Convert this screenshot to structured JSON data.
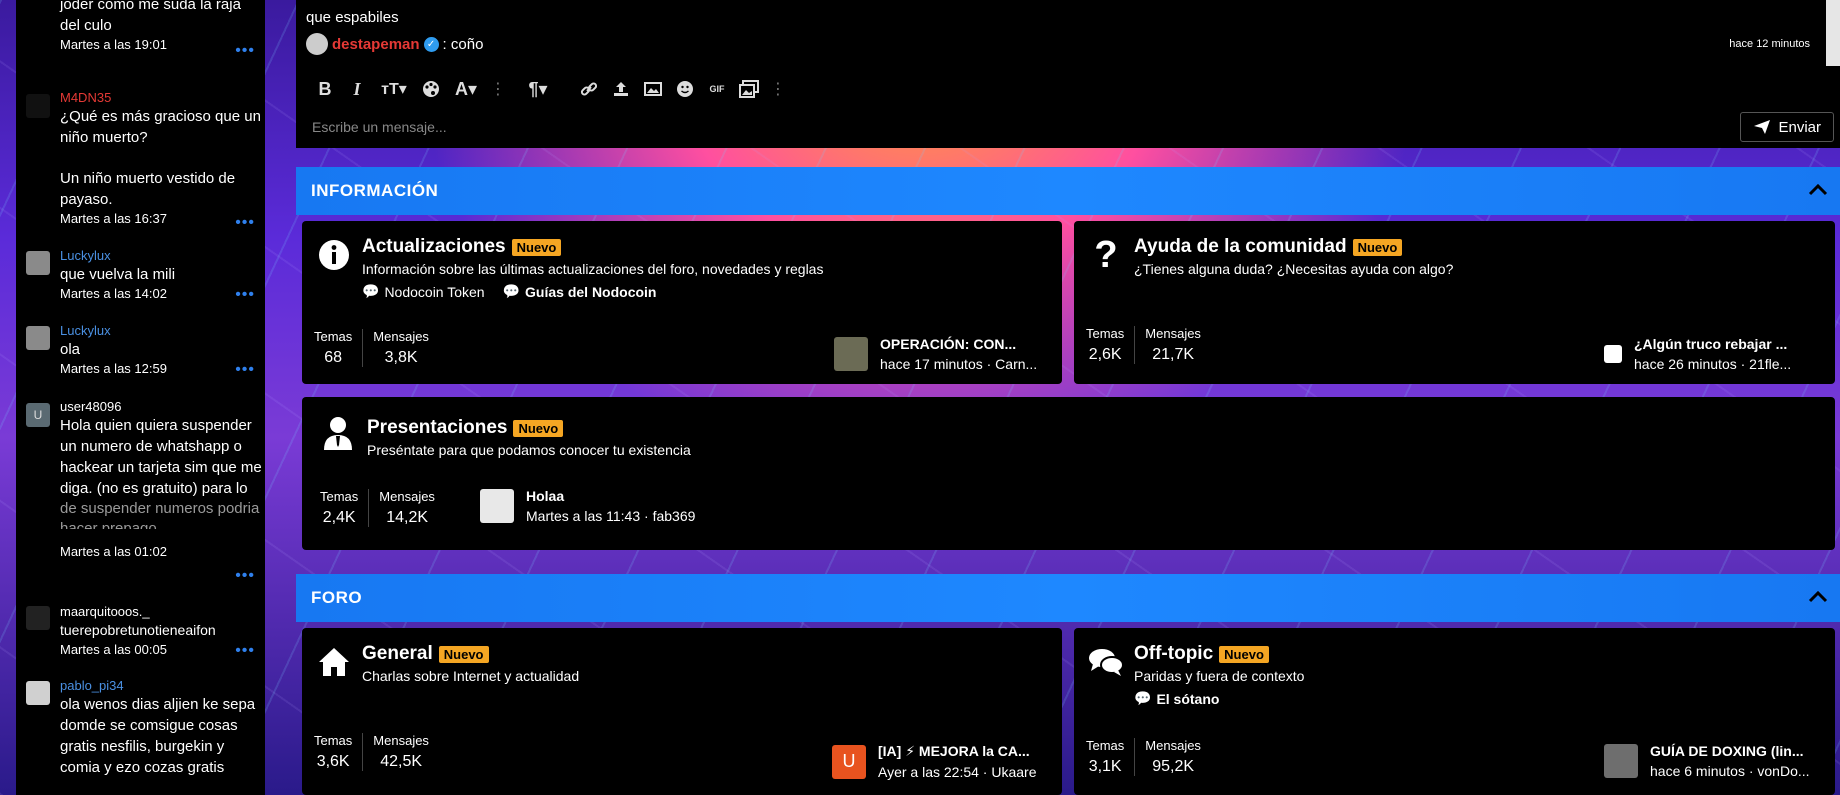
{
  "shoutbox": {
    "messages": [
      {
        "user": "",
        "text": "joder como me suda la raja del culo",
        "time": "Martes a las 19:01"
      },
      {
        "user": "M4DN35",
        "text": "¿Qué es más gracioso que un niño muerto?",
        "text2": "Un niño muerto vestido de payaso.",
        "time": "Martes a las 16:37"
      },
      {
        "user": "Luckylux",
        "text": "que vuelva la mili",
        "time": "Martes a las 14:02"
      },
      {
        "user": "Luckylux",
        "text": "ola",
        "time": "Martes a las 12:59"
      },
      {
        "user": "user48096",
        "avatar_letter": "U",
        "text": "Hola quien quiera suspender un numero de whatshapp o hackear un tarjeta sim que me diga. (no es gratuito) para lo",
        "text_faded": "de suspender numeros podria hacer prepago",
        "time": "Martes a las 01:02"
      },
      {
        "user": "maarquitooos._",
        "text": "tuerepobretunotieneaifon",
        "time": "Martes a las 00:05"
      },
      {
        "user": "pablo_pi34",
        "text": "ola wenos dias aljien ke sepa domde se comsigue cosas gratis nesfilis, burgekin y comia y ezo cozas gratis"
      }
    ],
    "more_label": "•••"
  },
  "chat": {
    "prev_text": "que espabiles",
    "last_user": "destapeman",
    "last_text": ": coño",
    "last_time": "hace 12 minutos",
    "input_placeholder": "Escribe un mensaje...",
    "send_label": "Enviar",
    "toolbar_icons": [
      "bold-icon",
      "italic-icon",
      "text-size-icon",
      "palette-icon",
      "font-icon",
      "more-icon",
      "paragraph-icon",
      "link-icon",
      "upload-icon",
      "image-icon",
      "smilie-icon",
      "gif-icon",
      "media-icon",
      "more-icon"
    ]
  },
  "categories": {
    "info": {
      "title": "INFORMACIÓN"
    },
    "foro": {
      "title": "FORO"
    }
  },
  "nodes": {
    "actualizaciones": {
      "title": "Actualizaciones",
      "badge": "Nuevo",
      "desc": "Información sobre las últimas actualizaciones del foro, novedades y reglas",
      "sub1": "Nodocoin Token",
      "sub2": "Guías del Nodocoin",
      "temas_label": "Temas",
      "temas": "68",
      "mensajes_label": "Mensajes",
      "mensajes": "3,8K",
      "last_title": "OPERACIÓN: CON...",
      "last_meta": "hace 17 minutos · Carn..."
    },
    "ayuda": {
      "title": "Ayuda de la comunidad",
      "badge": "Nuevo",
      "desc": "¿Tienes alguna duda? ¿Necesitas ayuda con algo?",
      "temas_label": "Temas",
      "temas": "2,6K",
      "mensajes_label": "Mensajes",
      "mensajes": "21,7K",
      "last_title": "¿Algún truco rebajar ...",
      "last_meta": "hace 26 minutos · 21fle..."
    },
    "presentaciones": {
      "title": "Presentaciones",
      "badge": "Nuevo",
      "desc": "Preséntate para que podamos conocer tu existencia",
      "temas_label": "Temas",
      "temas": "2,4K",
      "mensajes_label": "Mensajes",
      "mensajes": "14,2K",
      "last_title": "Holaa",
      "last_meta": "Martes a las 11:43 · fab369"
    },
    "general": {
      "title": "General",
      "badge": "Nuevo",
      "desc": "Charlas sobre Internet y actualidad",
      "temas_label": "Temas",
      "temas": "3,6K",
      "mensajes_label": "Mensajes",
      "mensajes": "42,5K",
      "last_avatar": "U",
      "last_title": "[IA] ⚡ MEJORA la CA...",
      "last_meta": "Ayer a las 22:54 · Ukaare"
    },
    "offtopic": {
      "title": "Off-topic",
      "badge": "Nuevo",
      "desc": "Paridas y fuera de contexto",
      "sub1": "El sótano",
      "temas_label": "Temas",
      "temas": "3,1K",
      "mensajes_label": "Mensajes",
      "mensajes": "95,2K",
      "last_title": "GUÍA DE DOXING (lin...",
      "last_meta": "hace 6 minutos · vonDo..."
    }
  },
  "colors": {
    "accent": "#1e88ff",
    "badge": "#f5a623",
    "user_red": "#e53935",
    "user_blue": "#4a90e2"
  }
}
